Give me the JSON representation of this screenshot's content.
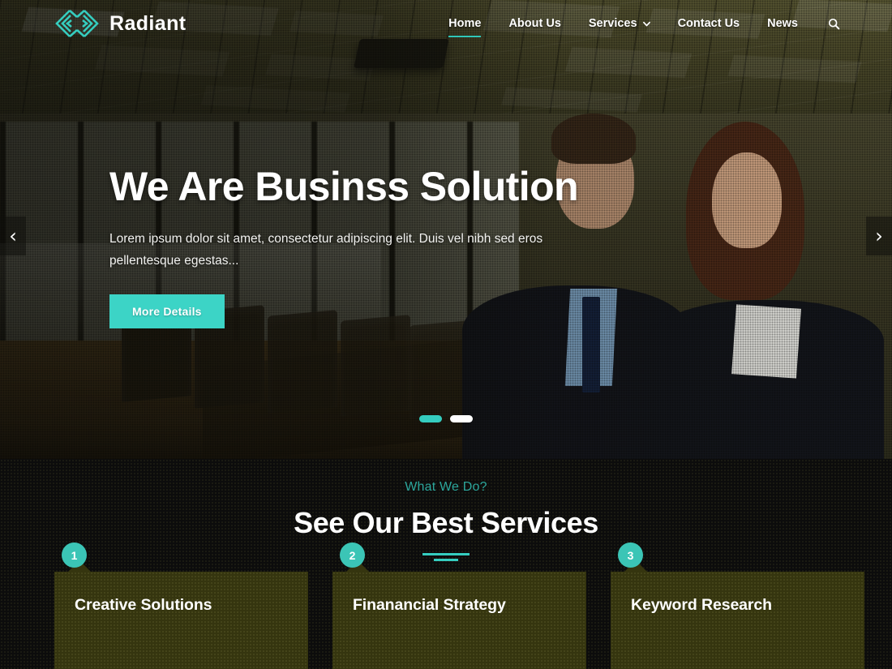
{
  "brand": {
    "name": "Radiant",
    "logo_icon": "radiant-diamond-logo",
    "accent": "#35cdbf"
  },
  "nav": {
    "items": [
      {
        "label": "Home",
        "active": true,
        "has_dropdown": false
      },
      {
        "label": "About Us",
        "active": false,
        "has_dropdown": false
      },
      {
        "label": "Services",
        "active": false,
        "has_dropdown": true
      },
      {
        "label": "Contact Us",
        "active": false,
        "has_dropdown": false
      },
      {
        "label": "News",
        "active": false,
        "has_dropdown": false
      }
    ],
    "search_icon": "search-icon"
  },
  "hero": {
    "title": "We Are Businss Solution",
    "subtitle": "Lorem ipsum dolor sit amet, consectetur adipiscing elit. Duis vel nibh sed eros pellentesque egestas...",
    "cta_label": "More Details",
    "cta_color": "#3cd4c6",
    "prev_arrow": "‹",
    "next_arrow": "›",
    "slides": [
      {
        "active": true
      },
      {
        "active": false
      }
    ]
  },
  "services": {
    "eyebrow": "What We Do?",
    "title": "See Our Best Services",
    "eyebrow_color": "#2ca79c",
    "cards": [
      {
        "number": "1",
        "title": "Creative Solutions"
      },
      {
        "number": "2",
        "title": "Finanancial Strategy"
      },
      {
        "number": "3",
        "title": "Keyword Research"
      }
    ]
  }
}
